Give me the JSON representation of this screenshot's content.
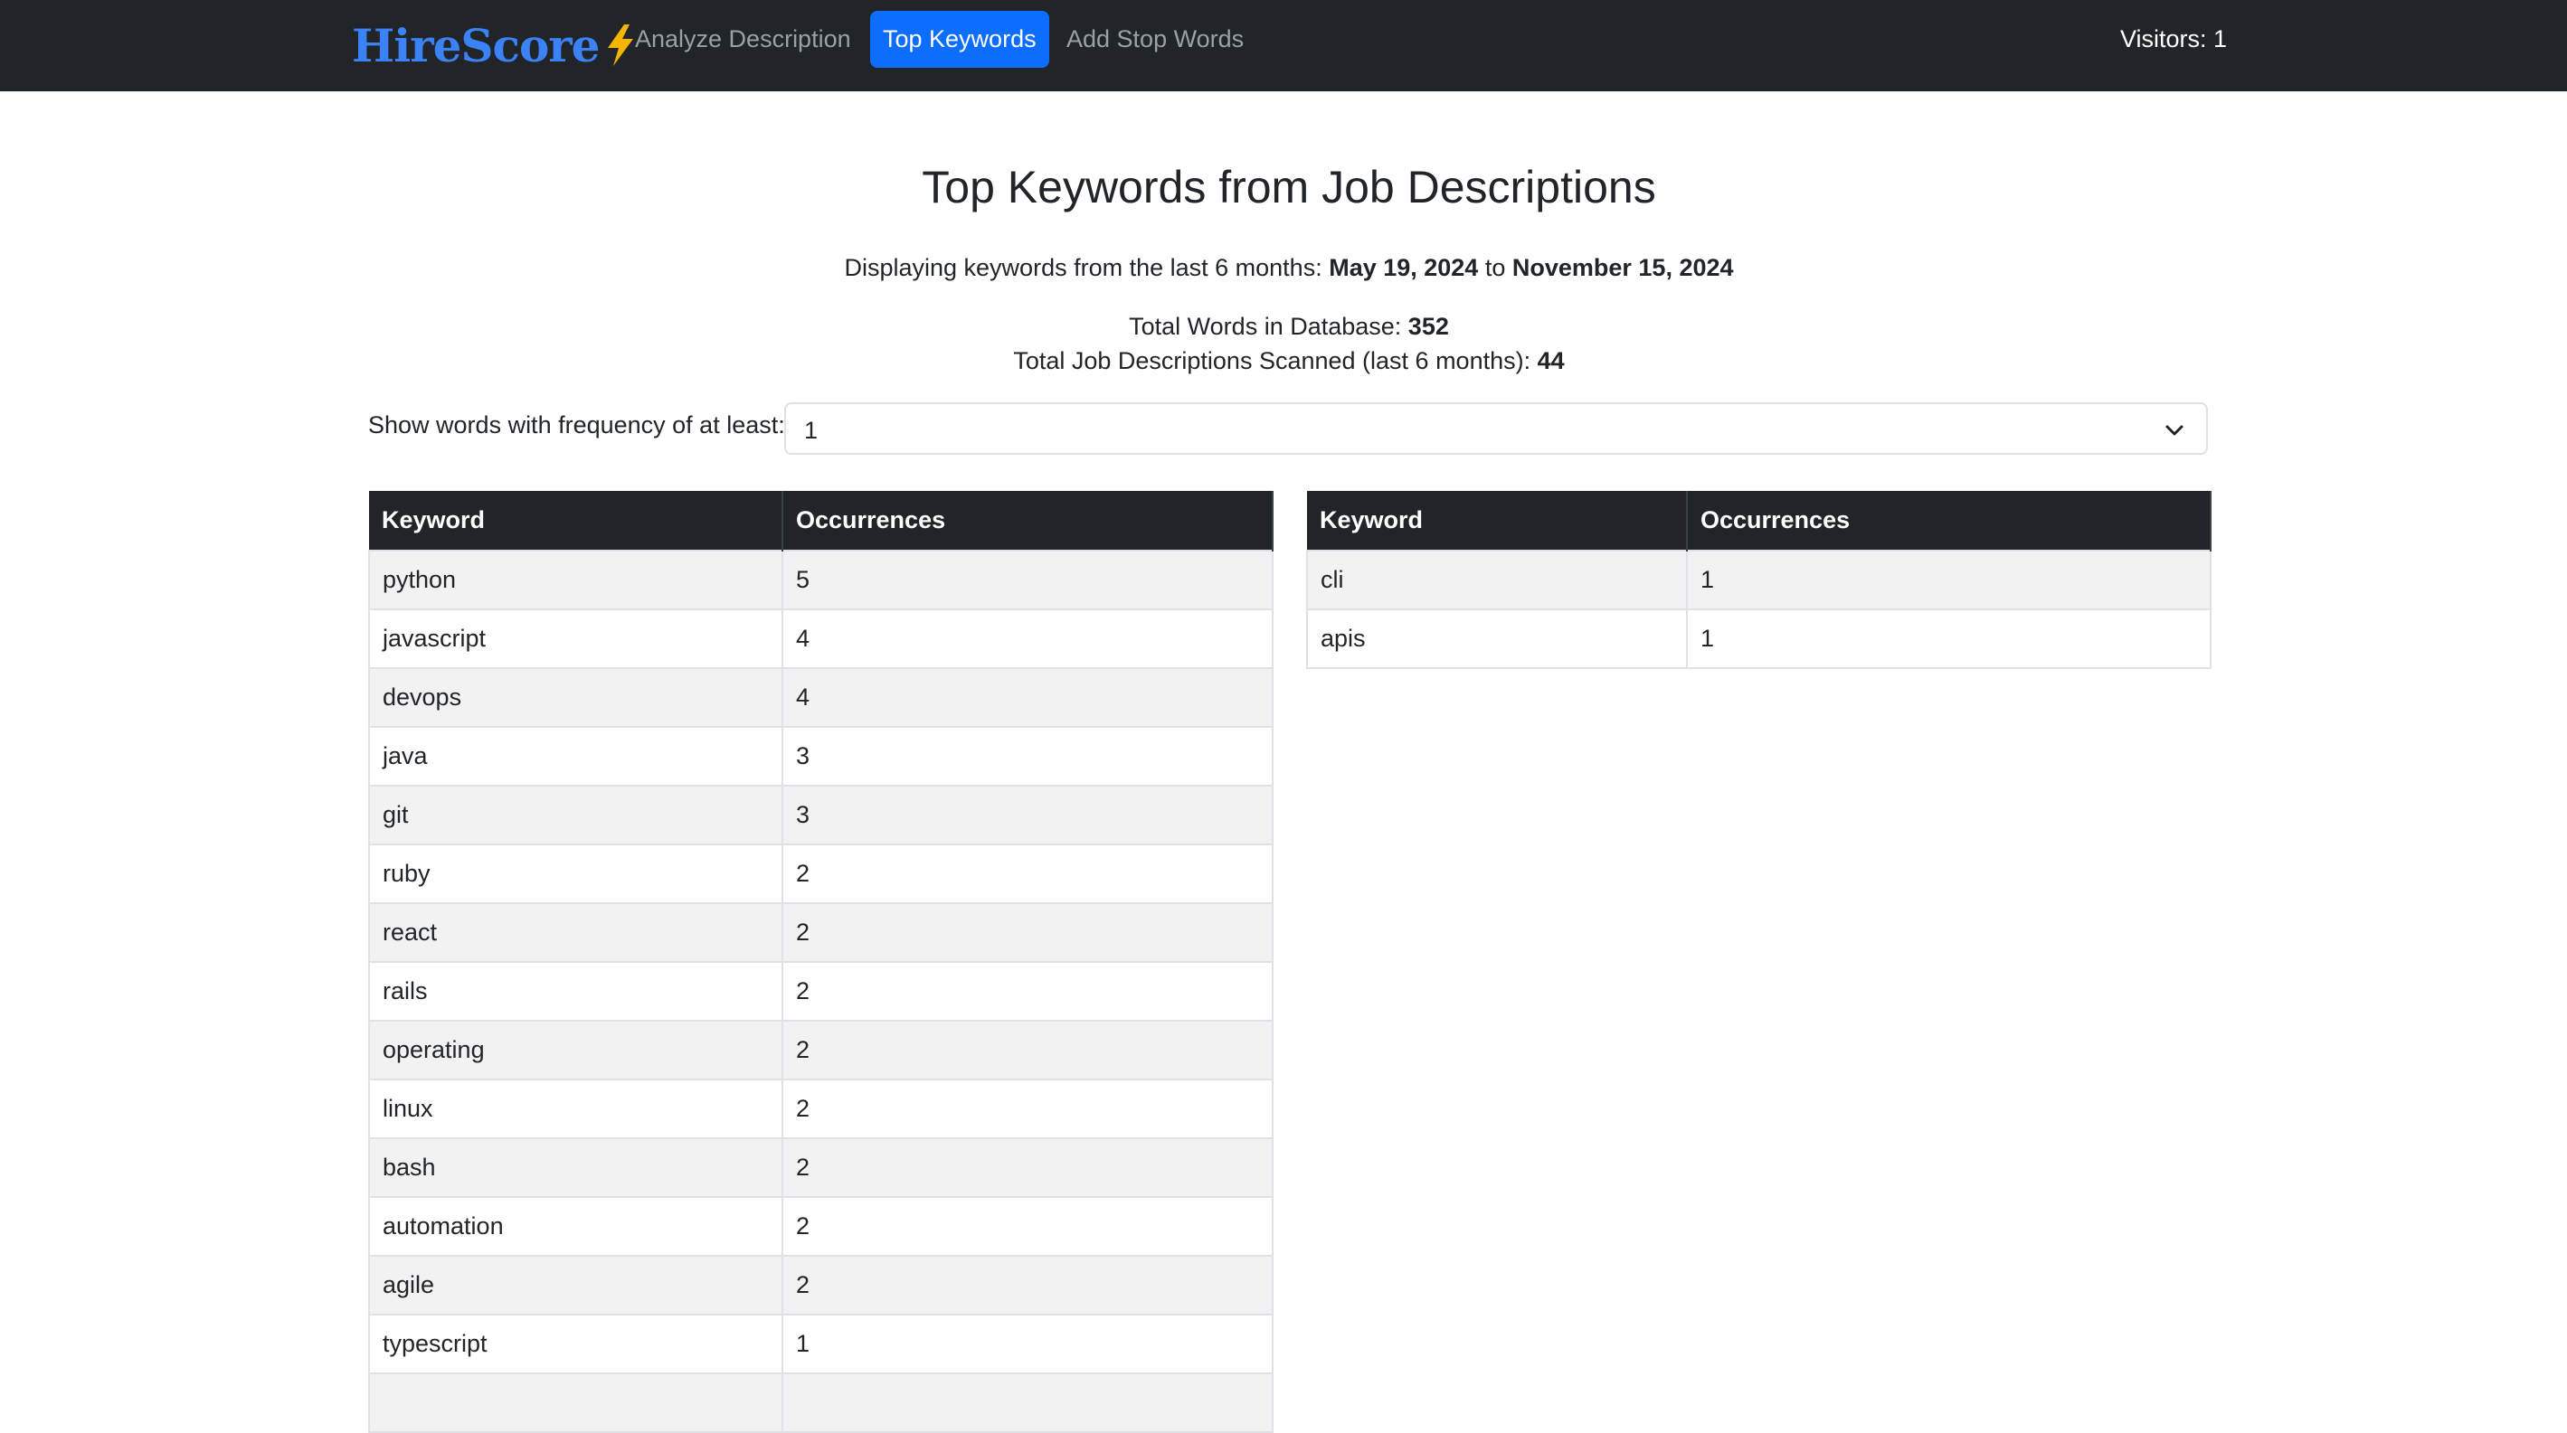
{
  "navbar": {
    "brand": "HireScore",
    "brand_icon": "lightning-bolt-icon",
    "links": [
      {
        "label": "Analyze Description",
        "active": false
      },
      {
        "label": "Top Keywords",
        "active": true
      },
      {
        "label": "Add Stop Words",
        "active": false
      }
    ],
    "visitors": "Visitors: 1"
  },
  "page": {
    "title": "Top Keywords from Job Descriptions",
    "range_prefix": "Displaying keywords from the last 6 months: ",
    "range_start": "May 19, 2024",
    "range_to": " to ",
    "range_end": "November 15, 2024",
    "total_words_label": "Total Words in Database: ",
    "total_words": "352",
    "total_jd_label": "Total Job Descriptions Scanned (last 6 months): ",
    "total_jd": "44"
  },
  "filter": {
    "label": "Show words with frequency of at least:",
    "value": "1"
  },
  "tables": {
    "headers": {
      "keyword": "Keyword",
      "occurrences": "Occurrences"
    },
    "left": [
      {
        "keyword": "python",
        "count": "5"
      },
      {
        "keyword": "javascript",
        "count": "4"
      },
      {
        "keyword": "devops",
        "count": "4"
      },
      {
        "keyword": "java",
        "count": "3"
      },
      {
        "keyword": "git",
        "count": "3"
      },
      {
        "keyword": "ruby",
        "count": "2"
      },
      {
        "keyword": "react",
        "count": "2"
      },
      {
        "keyword": "rails",
        "count": "2"
      },
      {
        "keyword": "operating",
        "count": "2"
      },
      {
        "keyword": "linux",
        "count": "2"
      },
      {
        "keyword": "bash",
        "count": "2"
      },
      {
        "keyword": "automation",
        "count": "2"
      },
      {
        "keyword": "agile",
        "count": "2"
      },
      {
        "keyword": "typescript",
        "count": "1"
      },
      {
        "keyword": "",
        "count": ""
      }
    ],
    "right": [
      {
        "keyword": "cli",
        "count": "1"
      },
      {
        "keyword": "apis",
        "count": "1"
      }
    ]
  },
  "colors": {
    "navbar_bg": "#212529",
    "brand": "#3b82f6",
    "active_link": "#0d6efd",
    "bolt": "#f5b400"
  }
}
